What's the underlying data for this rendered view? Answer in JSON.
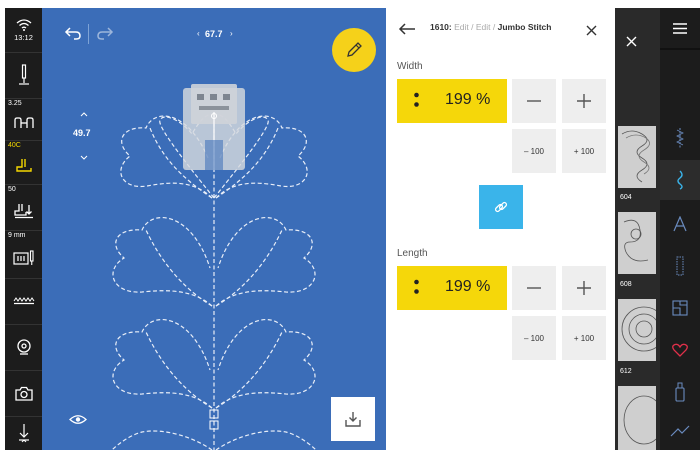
{
  "status": {
    "time": "13:12"
  },
  "left_rail": {
    "items": [
      {
        "label": "",
        "icon": "needle-icon"
      },
      {
        "label": "3.25",
        "icon": "stitch-length-icon"
      },
      {
        "label": "40C",
        "icon": "presser-foot-icon"
      },
      {
        "label": "50",
        "icon": "foot-pressure-icon"
      },
      {
        "label": "9 mm",
        "icon": "needle-plate-icon"
      },
      {
        "label": "",
        "icon": "feed-dog-icon"
      },
      {
        "label": "",
        "icon": "bobbin-icon"
      },
      {
        "label": "",
        "icon": "camera-icon"
      },
      {
        "label": "",
        "icon": "thread-cutter-icon"
      }
    ]
  },
  "canvas": {
    "top_value": "67.7",
    "side_value": "49.7"
  },
  "panel": {
    "breadcrumb": {
      "stitch_number": "1610:",
      "path": "Edit / Edit /",
      "current": "Jumbo Stitch"
    },
    "width": {
      "label": "Width",
      "value": "199 %",
      "minus_100": "– 100",
      "plus_100": "+ 100"
    },
    "length": {
      "label": "Length",
      "value": "199 %",
      "minus_100": "– 100",
      "plus_100": "+ 100"
    }
  },
  "stitch_list": {
    "items": [
      {
        "number": "604"
      },
      {
        "number": "608"
      },
      {
        "number": "612"
      }
    ]
  },
  "right_rail": {
    "items": [
      {
        "icon": "menu-icon"
      },
      {
        "icon": "practical-stitches-icon"
      },
      {
        "icon": "decorative-stitches-icon"
      },
      {
        "icon": "alphabet-icon"
      },
      {
        "icon": "buttonhole-icon"
      },
      {
        "icon": "quilt-icon"
      },
      {
        "icon": "favorites-icon"
      },
      {
        "icon": "usb-icon"
      },
      {
        "icon": "sewing-assist-icon"
      }
    ]
  },
  "colors": {
    "canvas_blue": "#3b6db8",
    "accent_yellow": "#f5d70a",
    "link_blue": "#3ab4ea",
    "favorite_red": "#e0304a",
    "rail_dark": "#1c1c1c"
  }
}
